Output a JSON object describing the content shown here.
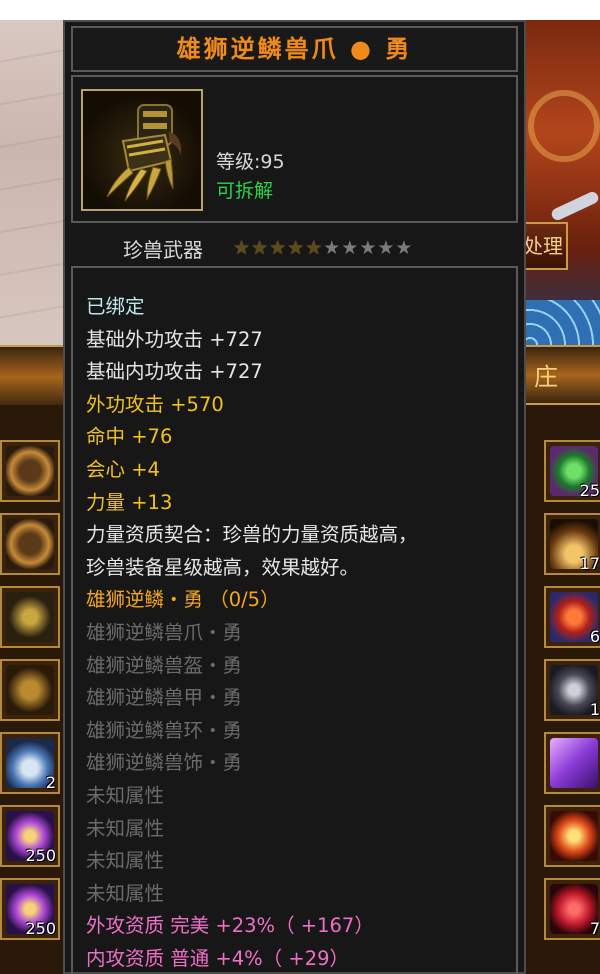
{
  "item": {
    "name": "雄狮逆鳞兽爪 ● 勇",
    "level_label": "等级:95",
    "dismantle_label": "可拆解",
    "type_label": "珍兽武器",
    "stars_filled": 5,
    "stars_total": 10,
    "lines": [
      {
        "text": "已绑定",
        "color": "cyan"
      },
      {
        "text": "基础外功攻击  +727",
        "color": "white"
      },
      {
        "text": "基础内功攻击  +727",
        "color": "white"
      },
      {
        "text": "外功攻击  +570",
        "color": "gold"
      },
      {
        "text": "命中  +76",
        "color": "gold"
      },
      {
        "text": "会心  +4",
        "color": "gold"
      },
      {
        "text": "力量  +13",
        "color": "gold"
      },
      {
        "text": "力量资质契合：珍兽的力量资质越高，",
        "color": "white"
      },
      {
        "text": "珍兽装备星级越高，效果越好。",
        "color": "white"
      },
      {
        "text": "雄狮逆鳞・勇  （0/5）",
        "color": "orange"
      },
      {
        "text": "雄狮逆鳞兽爪・勇",
        "color": "gray"
      },
      {
        "text": "雄狮逆鳞兽盔・勇",
        "color": "gray"
      },
      {
        "text": "雄狮逆鳞兽甲・勇",
        "color": "gray"
      },
      {
        "text": "雄狮逆鳞兽环・勇",
        "color": "gray"
      },
      {
        "text": "雄狮逆鳞兽饰・勇",
        "color": "gray"
      },
      {
        "text": "未知属性",
        "color": "gray"
      },
      {
        "text": "未知属性",
        "color": "gray"
      },
      {
        "text": "未知属性",
        "color": "gray"
      },
      {
        "text": "未知属性",
        "color": "gray"
      },
      {
        "text": "外攻资质   完美 +23%（ +167）",
        "color": "pink"
      },
      {
        "text": "内攻资质   普通 +4%（ +29）",
        "color": "pink"
      }
    ]
  },
  "background": {
    "process_button": "处理",
    "right_banner": "庄",
    "left_slots": [
      {
        "icon": "collar-icon",
        "count": ""
      },
      {
        "icon": "collar-icon",
        "count": ""
      },
      {
        "icon": "claw-icon",
        "count": ""
      },
      {
        "icon": "helmet-icon",
        "count": ""
      },
      {
        "icon": "potion-icon",
        "count": "2"
      },
      {
        "icon": "orb-icon",
        "count": "250"
      },
      {
        "icon": "orb-icon",
        "count": "250"
      }
    ],
    "right_slots": [
      {
        "icon": "gem-icon",
        "count": "25"
      },
      {
        "icon": "pile-icon",
        "count": "17"
      },
      {
        "icon": "fire-icon",
        "count": "6"
      },
      {
        "icon": "stone-icon",
        "count": "1"
      },
      {
        "icon": "scroll-icon",
        "count": ""
      },
      {
        "icon": "fruit-icon",
        "count": ""
      },
      {
        "icon": "ruby-icon",
        "count": "7"
      }
    ]
  },
  "colors": {
    "title": "#f08a1a",
    "dismantle": "#2bd24a",
    "attr_gold": "#f2c21a",
    "set_orange": "#f5a623",
    "inactive_gray": "#6b6b6b",
    "aptitude_pink": "#ee6fc8"
  }
}
